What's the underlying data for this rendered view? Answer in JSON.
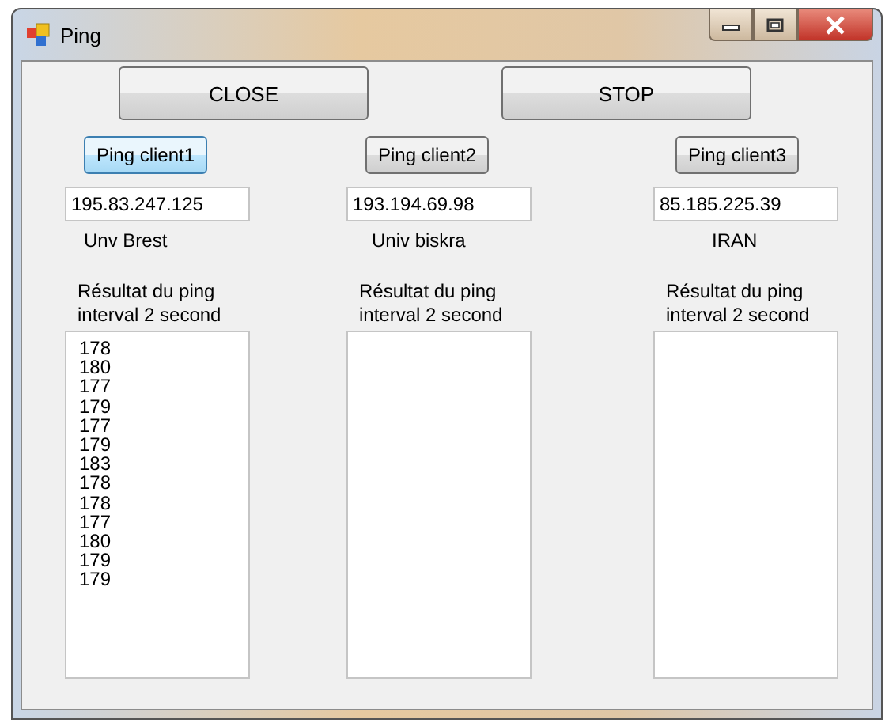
{
  "window": {
    "title": "Ping"
  },
  "buttons": [
    "CLOSE",
    "STOP"
  ],
  "clients": [
    {
      "button": "Ping client1",
      "focused": true,
      "address": "195.83.247.125",
      "name": "Unv Brest",
      "result_label": "Résultat du ping interval 2 second",
      "results": [
        "178",
        "180",
        "177",
        "179",
        "177",
        "179",
        "183",
        "178",
        "178",
        "177",
        "180",
        "179",
        "179"
      ]
    },
    {
      "button": "Ping client2",
      "focused": false,
      "address": "193.194.69.98",
      "name": "Univ biskra",
      "result_label": "Résultat du ping interval 2 second"
    },
    {
      "button": "Ping client3",
      "focused": false,
      "address": "85.185.225.39",
      "name": "IRAN",
      "result_label": "Résultat du ping interval 2 second"
    }
  ]
}
